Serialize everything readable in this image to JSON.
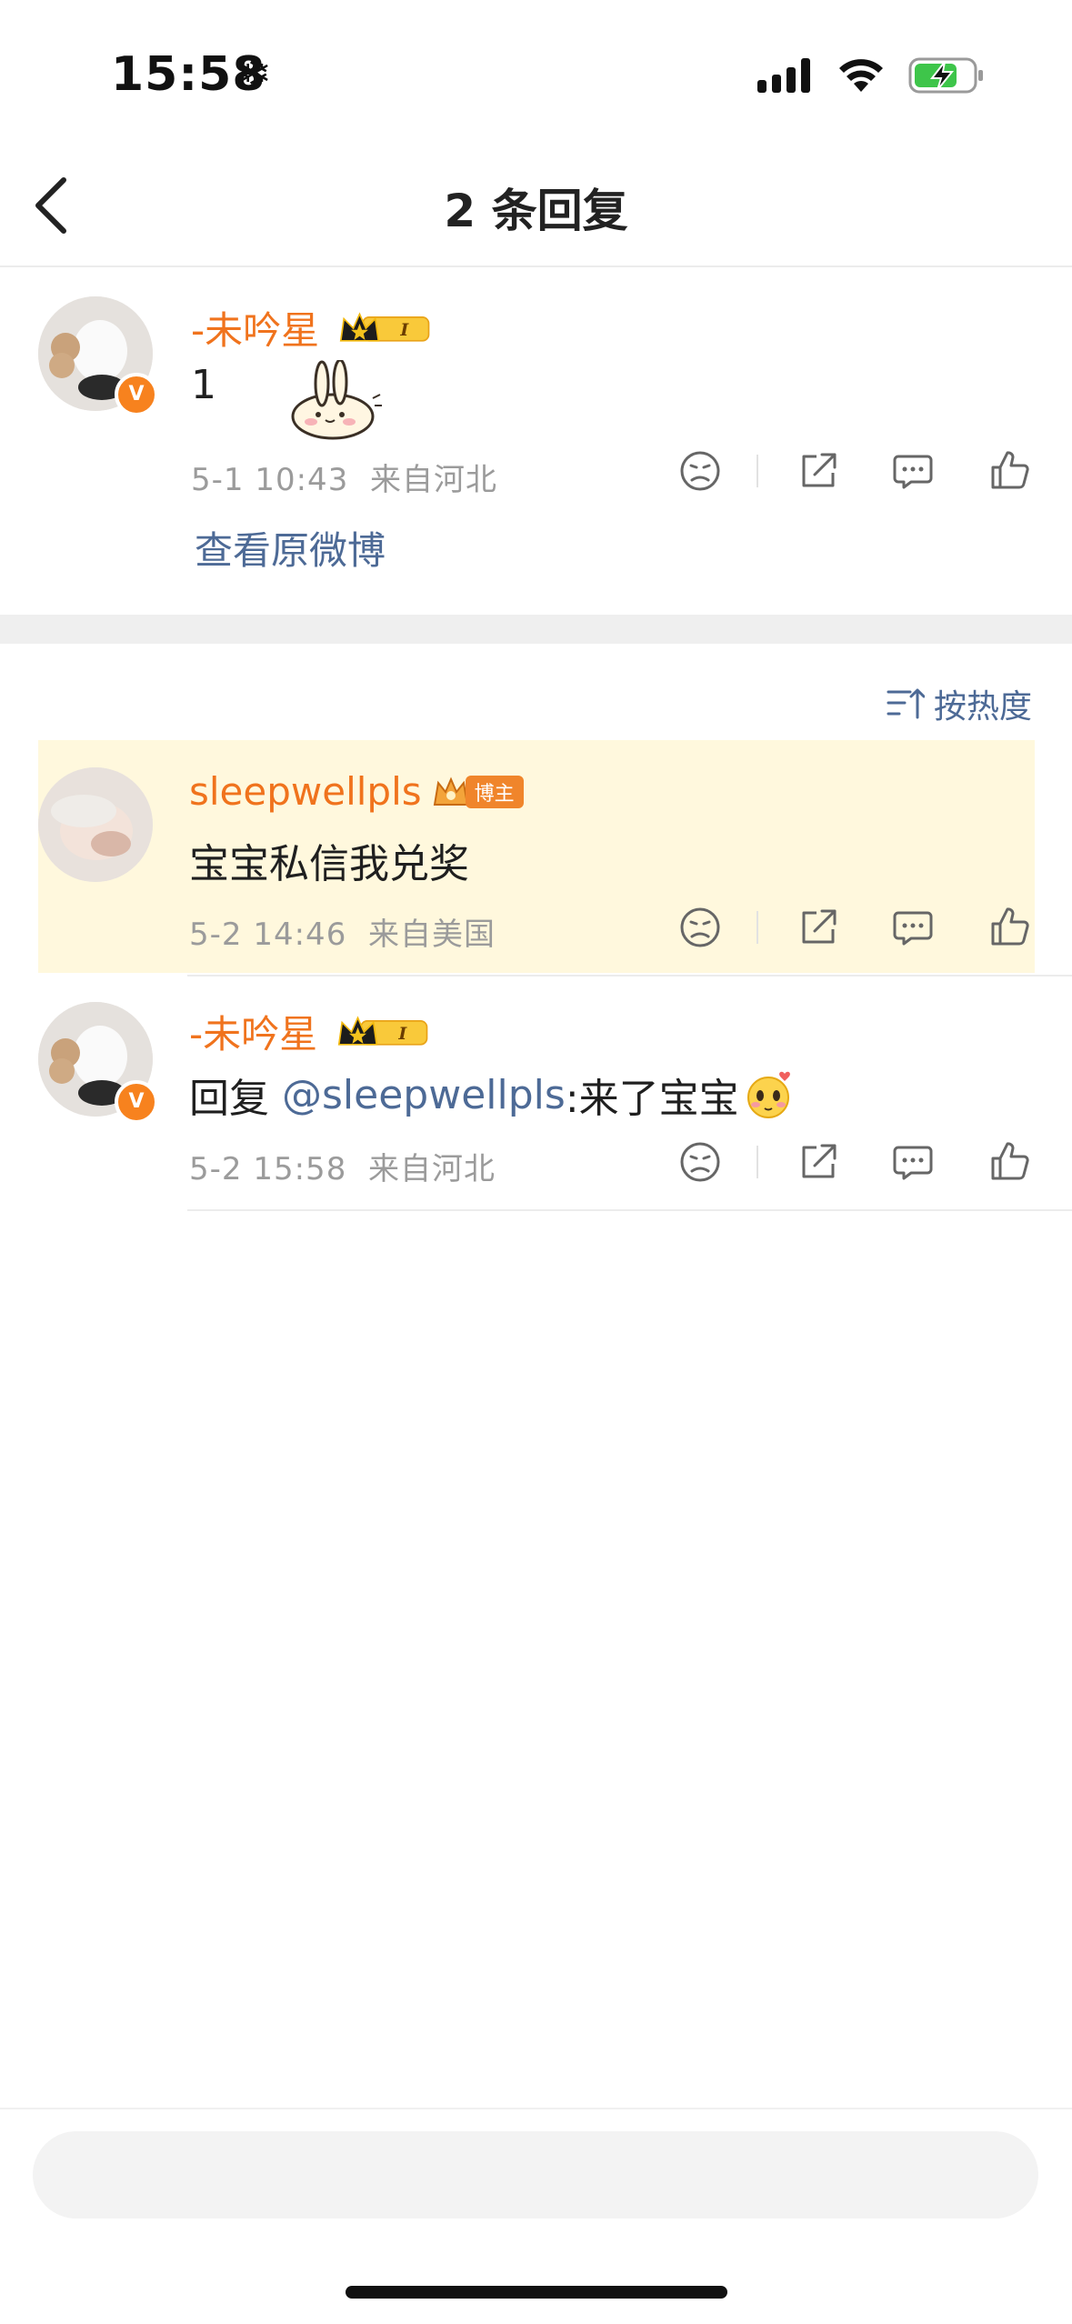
{
  "status": {
    "time": "15:58",
    "snow": "❄"
  },
  "nav": {
    "title": "2 条回复"
  },
  "root_comment": {
    "username": "-未吟星",
    "text": "1",
    "time": "5-1 10:43",
    "location": "来自河北",
    "view_original": "查看原微博"
  },
  "sort": {
    "label": "按热度"
  },
  "replies": [
    {
      "username": "sleepwellpls",
      "badge": "博主",
      "text": "宝宝私信我兑奖",
      "time": "5-2 14:46",
      "location": "来自美国"
    },
    {
      "username": "-未吟星",
      "reply_prefix": "回复 ",
      "mention": "@sleepwellpls",
      "text": ":来了宝宝",
      "time": "5-2 15:58",
      "location": "来自河北"
    }
  ],
  "colors": {
    "accent_orange": "#f0731d",
    "link_blue": "#4d6a96",
    "highlight_bg": "#fff8dd"
  }
}
